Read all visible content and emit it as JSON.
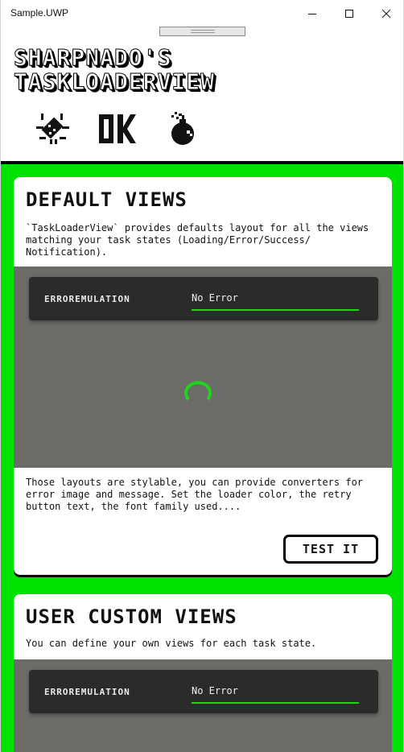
{
  "window": {
    "title": "Sample.UWP",
    "controls": {
      "minimize": "minimize-icon",
      "maximize": "maximize-icon",
      "close": "close-icon"
    }
  },
  "header": {
    "title_line1": "SHARPNADO'S",
    "title_line2": "TASKLOADERVIEW",
    "status_icons": [
      "bug-icon",
      "ok-icon",
      "bomb-icon"
    ],
    "ok_label": "OK"
  },
  "colors": {
    "background_green": "#00e100",
    "emulation_underline": "#1fd41f",
    "demo_area": "#6b6b67",
    "error_bar": "#2b2b2b"
  },
  "cards": [
    {
      "title": "DEFAULT VIEWS",
      "description": "`TaskLoaderView` provides defaults layout for all the views matching your task states (Loading/Error/Success/ Notification).",
      "error_emulation": {
        "label": "ERROREMULATION",
        "value": "No Error"
      },
      "note": "Those layouts are stylable, you can provide converters for error image and message. Set the loader color, the retry button text, the font family used....",
      "button_label": "TEST IT"
    },
    {
      "title": "USER CUSTOM VIEWS",
      "description": "You can define your own views for each task state.",
      "error_emulation": {
        "label": "ERROREMULATION",
        "value": "No Error"
      }
    }
  ]
}
